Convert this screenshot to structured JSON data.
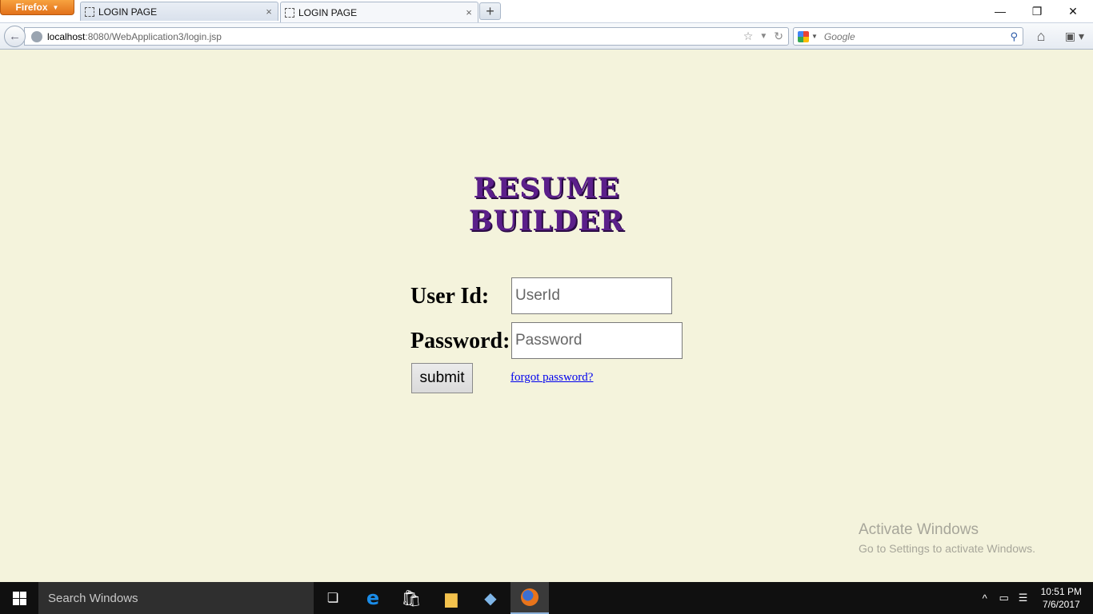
{
  "browser": {
    "menu_label": "Firefox",
    "tabs": [
      {
        "title": "LOGIN PAGE",
        "active": false
      },
      {
        "title": "LOGIN PAGE",
        "active": true
      }
    ],
    "url_host": "localhost",
    "url_path": ":8080/WebApplication3/login.jsp",
    "search_placeholder": "Google"
  },
  "page": {
    "heading": "RESUME BUILDER",
    "userid_label": "User Id:",
    "userid_placeholder": "UserId",
    "password_label": "Password:",
    "password_placeholder": "Password",
    "submit_label": "submit",
    "forgot_link": "forgot password?",
    "heading_color": "#5b1f8a",
    "background_color": "#f4f3dc"
  },
  "watermark": {
    "line1": "Activate Windows",
    "line2": "Go to Settings to activate Windows."
  },
  "taskbar": {
    "search_placeholder": "Search Windows",
    "time": "10:51 PM",
    "date": "7/6/2017",
    "pinned": [
      "task-view-icon",
      "edge-icon",
      "store-icon",
      "file-explorer-icon",
      "app-cube-icon",
      "firefox-icon"
    ]
  }
}
